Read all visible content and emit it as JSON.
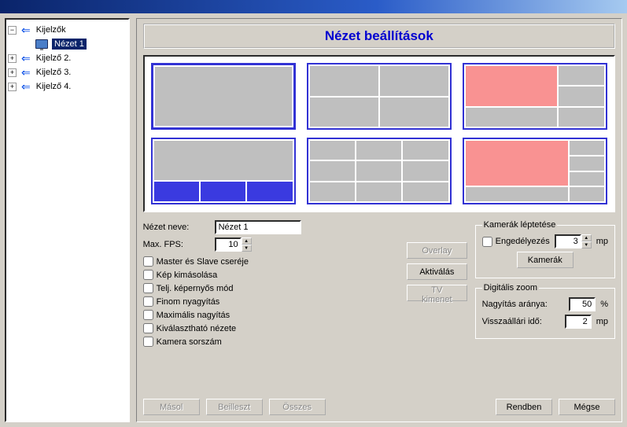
{
  "tree": {
    "root_label": "Kijelzők",
    "selected_label": "Nézet 1",
    "items": [
      {
        "label": "Kijelző 2."
      },
      {
        "label": "Kijelző 3."
      },
      {
        "label": "Kijelző 4."
      }
    ]
  },
  "panel_title": "Nézet beállítások",
  "form": {
    "name_label": "Nézet neve:",
    "name_value": "Nézet 1",
    "fps_label": "Max. FPS:",
    "fps_value": "10",
    "checks": {
      "master_slave": "Master és Slave cseréje",
      "copy_image": "Kép kimásolása",
      "fullscreen": "Telj. képernyős mód",
      "fine_zoom": "Finom nyagyítás",
      "max_zoom": "Maximális nagyítás",
      "selectable_view": "Kiválasztható nézete",
      "camera_serial": "Kamera sorszám"
    }
  },
  "mid": {
    "overlay": "Overlay",
    "activate": "Aktiválás",
    "tv_out": "TV kimenet"
  },
  "cameras_group": {
    "legend": "Kamerák léptetése",
    "enable": "Engedélyezés",
    "interval_value": "3",
    "unit": "mp",
    "button": "Kamerák"
  },
  "zoom_group": {
    "legend": "Digitális zoom",
    "ratio_label": "Nagyítás aránya:",
    "ratio_value": "50",
    "ratio_unit": "%",
    "reset_label": "Visszaállári idő:",
    "reset_value": "2",
    "reset_unit": "mp"
  },
  "bottom": {
    "copy": "Másol",
    "paste": "Beilleszt",
    "all": "Összes",
    "ok": "Rendben",
    "cancel": "Mégse"
  },
  "icons": {
    "minus": "−",
    "plus": "+",
    "arrow": "⇐",
    "up": "▲",
    "down": "▼"
  }
}
